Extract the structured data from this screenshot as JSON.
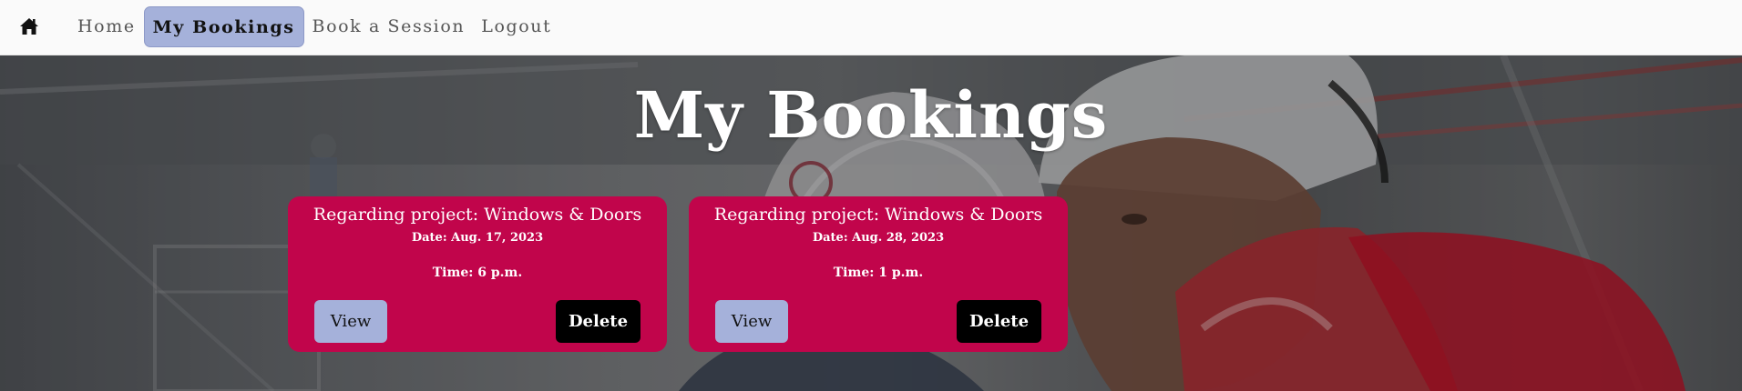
{
  "nav": {
    "home_icon": "home-icon",
    "links": [
      {
        "label": "Home",
        "active": false
      },
      {
        "label": "My Bookings",
        "active": true
      },
      {
        "label": "Book a Session",
        "active": false
      },
      {
        "label": "Logout",
        "active": false
      }
    ]
  },
  "page": {
    "title": "My Bookings"
  },
  "bookings": [
    {
      "title": "Regarding project: Windows & Doors",
      "date": "Date: Aug. 17, 2023",
      "time": "Time: 6 p.m.",
      "view_label": "View",
      "delete_label": "Delete"
    },
    {
      "title": "Regarding project: Windows & Doors",
      "date": "Date: Aug. 28, 2023",
      "time": "Time: 1 p.m.",
      "view_label": "View",
      "delete_label": "Delete"
    }
  ],
  "colors": {
    "nav_active_bg": "#a5b1da",
    "card_bg": "#c1054b",
    "delete_bg": "#000000",
    "view_bg": "#a5b1da"
  }
}
